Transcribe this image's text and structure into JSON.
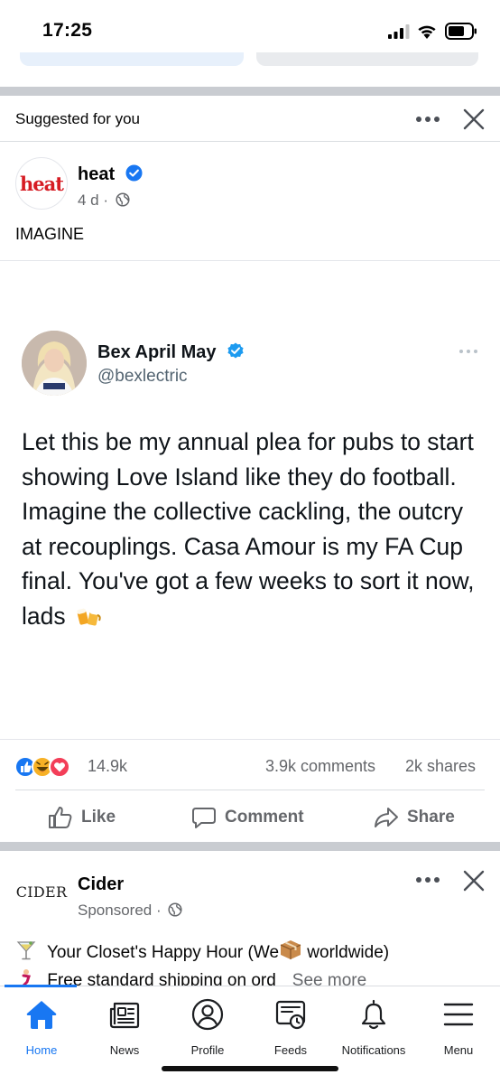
{
  "status_bar": {
    "time": "17:25"
  },
  "suggested": {
    "label": "Suggested for you"
  },
  "post": {
    "page_name": "heat",
    "page_logo_text": "heat",
    "age": "4 d",
    "separator": "·",
    "caption": "IMAGINE",
    "tweet": {
      "name": "Bex April May",
      "handle": "@bexlectric",
      "text": "Let this be my annual plea for pubs to start showing Love Island like they do football. Imagine the collective cackling, the outcry at recouplings. Casa Amour is my FA Cup final. You've got a few weeks to sort it now, lads"
    },
    "reactions_count": "14.9k",
    "comments_count": "3.9k comments",
    "shares_count": "2k shares",
    "actions": {
      "like": "Like",
      "comment": "Comment",
      "share": "Share"
    }
  },
  "ad": {
    "name": "Cider",
    "logo_text": "CIDER",
    "sponsored": "Sponsored",
    "separator": "·",
    "line1_before": "Your Closet's Happy Hour (We",
    "line1_after": " worldwide)",
    "line2": "Free standard shipping on ord",
    "see_more": "See more"
  },
  "tabs": [
    {
      "label": "Home",
      "icon": "home-icon",
      "active": true
    },
    {
      "label": "News",
      "icon": "news-icon",
      "active": false
    },
    {
      "label": "Profile",
      "icon": "profile-icon",
      "active": false
    },
    {
      "label": "Feeds",
      "icon": "feeds-icon",
      "active": false
    },
    {
      "label": "Notifications",
      "icon": "bell-icon",
      "active": false
    },
    {
      "label": "Menu",
      "icon": "menu-icon",
      "active": false
    }
  ],
  "colors": {
    "accent": "#1877f2",
    "secondary_text": "#65676b",
    "divider": "#c9ccd1",
    "heat_red": "#d61b23",
    "verified_blue": "#1d9bf0"
  }
}
